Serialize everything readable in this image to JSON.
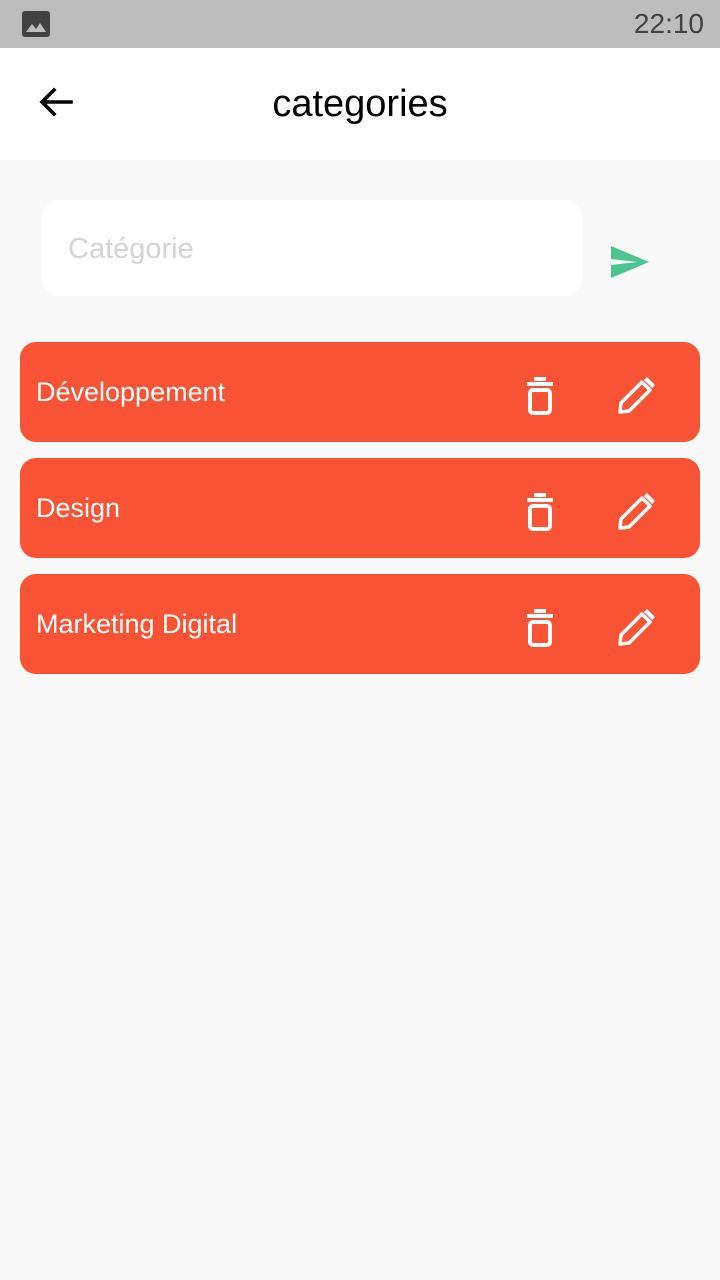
{
  "status_bar": {
    "time": "22:10",
    "notification_icon": "image-icon"
  },
  "header": {
    "title": "categories",
    "back_icon": "arrow-back-icon"
  },
  "form": {
    "input_value": "",
    "input_placeholder": "Catégorie",
    "send_icon": "send-icon",
    "send_color": "#4dc591"
  },
  "categories": [
    {
      "label": "Développement"
    },
    {
      "label": "Design"
    },
    {
      "label": "Marketing Digital"
    }
  ],
  "item_actions": {
    "delete_icon": "trash-icon",
    "edit_icon": "pencil-icon"
  },
  "colors": {
    "accent": "#f95335",
    "background": "#f9f9f9",
    "status_bar": "#bdbdbd"
  }
}
